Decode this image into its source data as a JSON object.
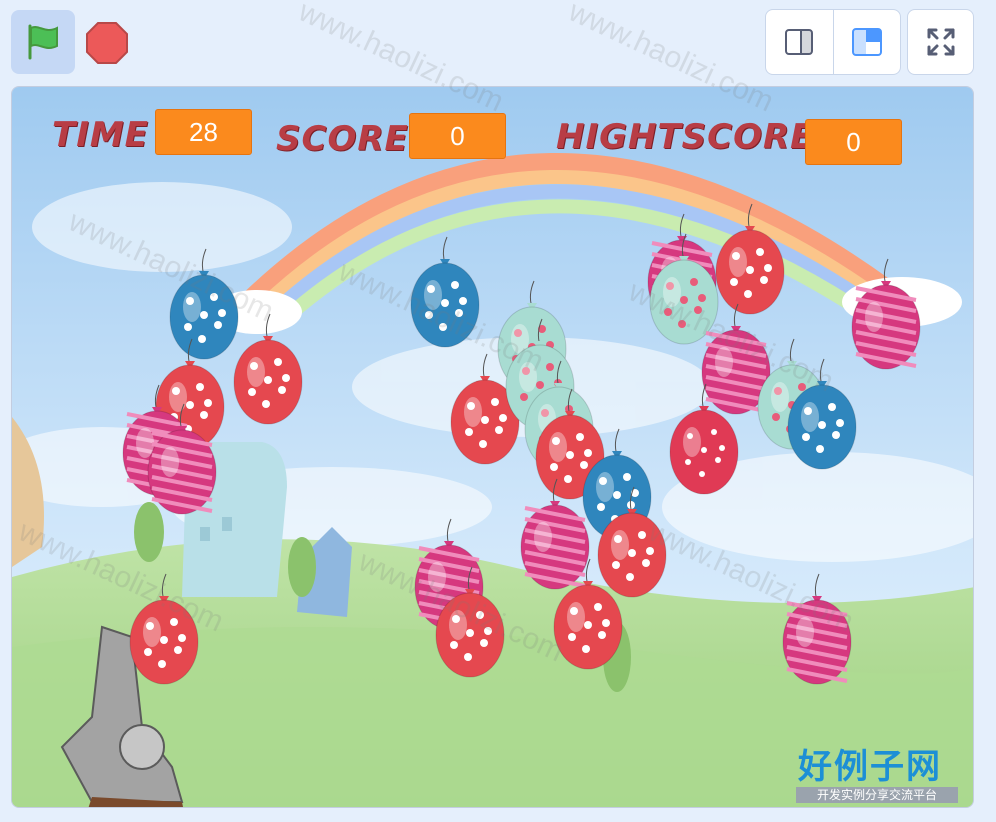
{
  "toolbar": {
    "green_flag_icon": "green-flag-icon",
    "stop_icon": "stop-sign-icon",
    "small_stage_icon": "small-stage-icon",
    "normal_stage_icon": "normal-stage-icon",
    "fullscreen_icon": "fullscreen-icon"
  },
  "hud": {
    "time_label": "TIME",
    "time_value": "28",
    "score_label": "SCORE",
    "score_value": "0",
    "highscore_label": "HIGHTSCORE",
    "highscore_value": "0"
  },
  "watermark": {
    "text": "www.haolizi.com",
    "logo_title": "好例子网",
    "logo_subtitle": "开发实例分享交流平台"
  },
  "colors": {
    "accent": "#4c97ff",
    "hud_box": "#fb8a1d",
    "hud_label": "#b83d45",
    "stop": "#ec5959",
    "flag": "#4cbf56"
  }
}
